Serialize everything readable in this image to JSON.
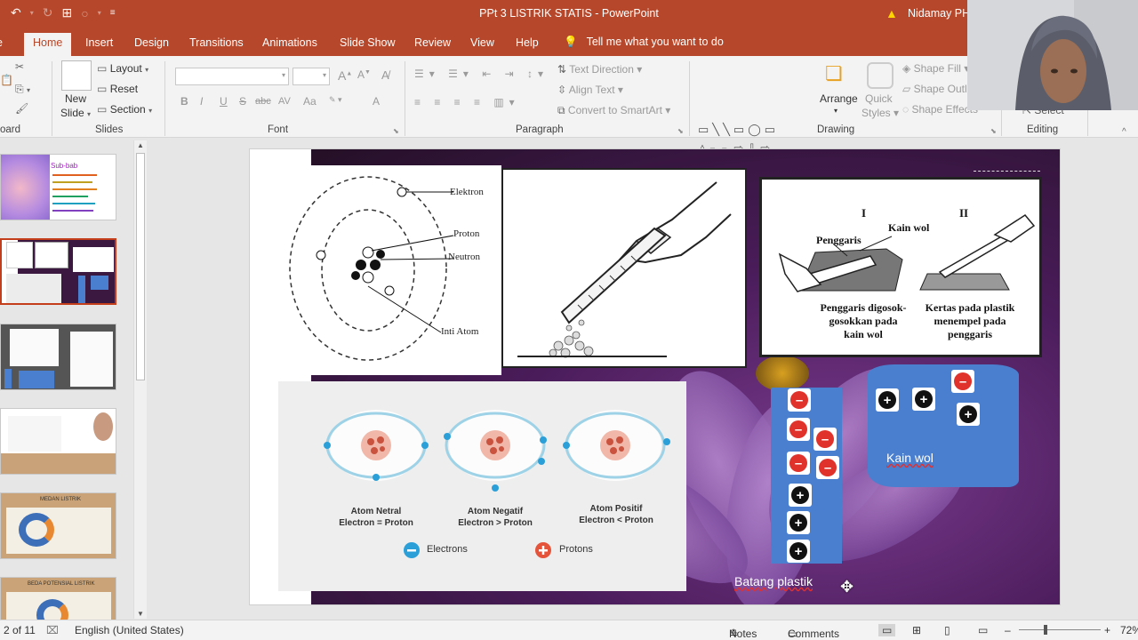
{
  "window": {
    "title": "PPt 3 LISTRIK STATIS  -  PowerPoint",
    "user": "Nidamay PH",
    "accent": "#b7472a"
  },
  "tabs": [
    "Home",
    "Insert",
    "Design",
    "Transitions",
    "Animations",
    "Slide Show",
    "Review",
    "View",
    "Help"
  ],
  "tell_me": "Tell me what you want to do",
  "ribbon": {
    "clipboard": "oard",
    "slides": {
      "label": "Slides",
      "new_slide": [
        "New",
        "Slide"
      ],
      "layout": "Layout",
      "reset": "Reset",
      "section": "Section"
    },
    "font": {
      "label": "Font",
      "buttons": [
        "B",
        "I",
        "U",
        "S",
        "abc",
        "AV",
        "Aa",
        "A"
      ]
    },
    "paragraph": {
      "label": "Paragraph",
      "text_direction": "Text Direction",
      "align_text": "Align Text",
      "convert_smartart": "Convert to SmartArt"
    },
    "drawing": {
      "label": "Drawing",
      "arrange": "Arrange",
      "quick_styles": [
        "Quick",
        "Styles"
      ],
      "shape_fill": "Shape Fill",
      "shape_outline": "Shape Outl",
      "shape_effects": "Shape Effects"
    },
    "editing": {
      "label": "Editing",
      "select": "Select"
    }
  },
  "thumbnails": {
    "count": 6,
    "selected_index": 1,
    "thumb1_title": "Sub-bab",
    "thumb5_title": "MEDAN LISTRIK",
    "thumb6_title": "BEDA POTENSIAL LISTRIK"
  },
  "slide": {
    "atom_diagram": {
      "labels": [
        "Elektron",
        "Proton",
        "Neutron",
        "Inti Atom"
      ]
    },
    "experiment": {
      "roman": [
        "I",
        "II"
      ],
      "kain_wol": "Kain wol",
      "penggaris": "Penggaris",
      "caption_left": [
        "Penggaris digosok-",
        "gosokkan pada",
        "kain wol"
      ],
      "caption_right": [
        "Kertas pada plastik",
        "menempel pada",
        "penggaris"
      ]
    },
    "atoms": [
      {
        "title": "Atom Netral",
        "relation": "Electron = Proton"
      },
      {
        "title": "Atom Negatif",
        "relation": "Electron > Proton"
      },
      {
        "title": "Atom Positif",
        "relation": "Electron < Proton"
      }
    ],
    "legend": {
      "electrons": "Electrons",
      "protons": "Protons",
      "electron_color": "#2a9fd8",
      "proton_color": "#e5533a"
    },
    "wool_label": "Kain wol",
    "rod_label": "Batang plastik"
  },
  "status": {
    "slide_counter": "2 of 11",
    "language": "English (United States)",
    "notes": "Notes",
    "comments": "Comments",
    "zoom": "72%"
  }
}
